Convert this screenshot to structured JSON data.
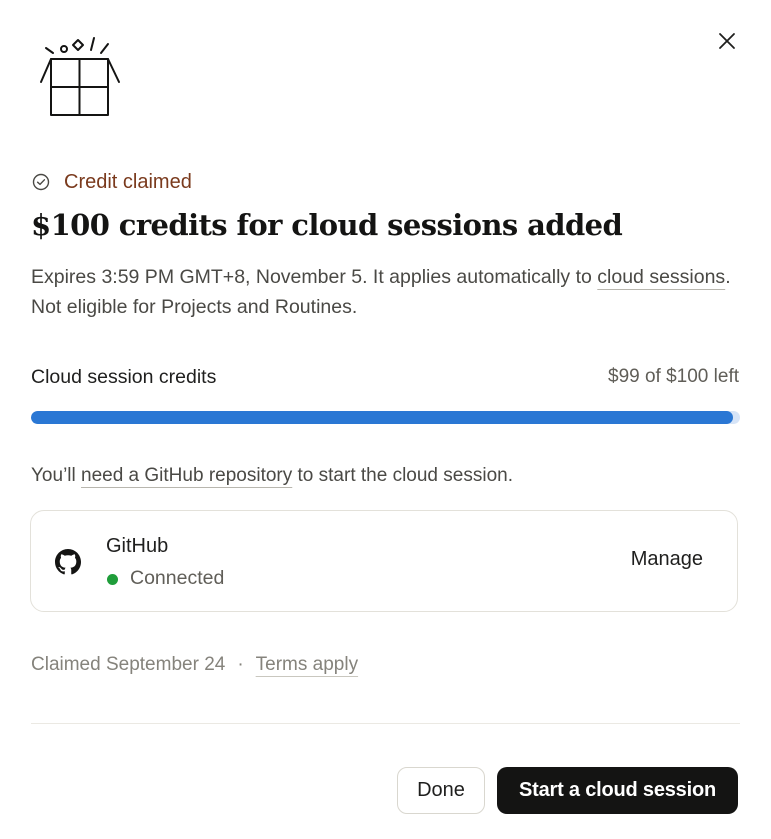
{
  "dialog": {
    "close_icon": "close-icon",
    "illustration_icon": "gift-box-icon",
    "claimed_label": "Credit claimed",
    "claimed_icon": "check-circle-icon",
    "title": "$100 credits for cloud sessions added",
    "description": {
      "text_before_link": "Expires 3:59 PM GMT+8, November 5. It applies automatically to ",
      "link_text": "cloud sessions",
      "text_after_link": ". Not eligible for Projects and Routines."
    },
    "credits": {
      "label": "Cloud session credits",
      "amount_text": "$99 of $100 left",
      "remaining": 99,
      "total": 100
    },
    "requirement": {
      "text_before_link": "You’ll ",
      "link_text": "need a GitHub repository",
      "text_after_link": " to start the cloud session."
    },
    "github": {
      "icon": "github-icon",
      "name": "GitHub",
      "status": "Connected",
      "manage_label": "Manage"
    },
    "footer": {
      "claimed_date": "Claimed September 24",
      "separator": "·",
      "terms_link": "Terms apply"
    },
    "buttons": {
      "done_label": "Done",
      "start_label": "Start a cloud session"
    },
    "colors": {
      "accent_brown": "#7a3a1d",
      "progress_blue": "#2a77d4",
      "status_green": "#1f9d3a",
      "primary_button": "#141413"
    }
  }
}
